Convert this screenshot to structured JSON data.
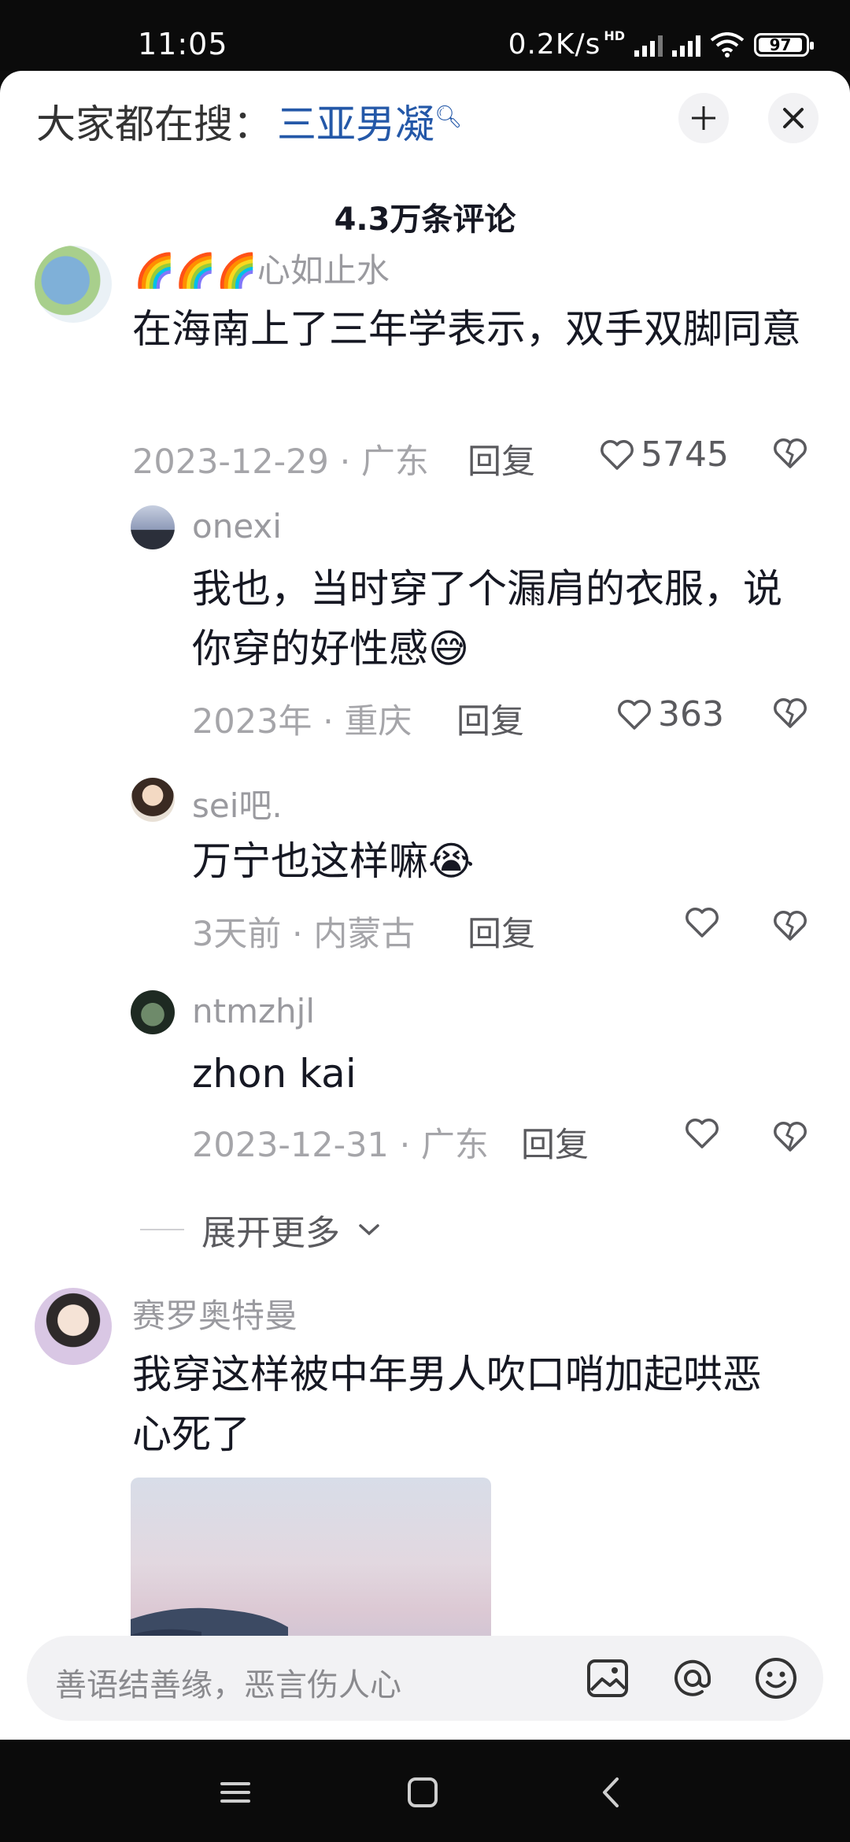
{
  "status_bar": {
    "time": "11:05",
    "net_speed": "0.2K/s",
    "hd": "HD",
    "battery": "97"
  },
  "header": {
    "prefix": "大家都在搜：",
    "keyword": "三亚男凝",
    "comment_count": "4.3万条评论"
  },
  "comments": [
    {
      "username": "🌈🌈🌈心如止水",
      "text": "在海南上了三年学表示，双手双脚同意",
      "meta": "2023-12-29 · 广东",
      "reply_label": "回复",
      "likes": "5745"
    },
    {
      "username": "onexi",
      "text": "我也，当时穿了个漏肩的衣服，说你穿的好性感😅",
      "meta": "2023年 · 重庆",
      "reply_label": "回复",
      "likes": "363"
    },
    {
      "username": "sei吧.",
      "text": "万宁也这样嘛😭",
      "meta": "3天前 · 内蒙古",
      "reply_label": "回复",
      "likes": ""
    },
    {
      "username": "ntmzhjl",
      "text": "zhon kai",
      "meta": "2023-12-31 · 广东",
      "reply_label": "回复",
      "likes": ""
    },
    {
      "username": "赛罗奥特曼",
      "text": "我穿这样被中年男人吹口哨加起哄恶心死了"
    }
  ],
  "expand_label": "展开更多",
  "input": {
    "placeholder": "善语结善缘，恶言伤人心"
  },
  "icons": {
    "search_hint": "magnifier-icon",
    "collapse": "collapse-icon",
    "close": "close-icon",
    "like": "heart-outline-icon",
    "dislike": "broken-heart-icon",
    "image": "image-icon",
    "mention": "at-icon",
    "emoji": "smiley-icon",
    "nav_menu": "menu-icon",
    "nav_home": "square-icon",
    "nav_back": "back-chevron-icon"
  }
}
